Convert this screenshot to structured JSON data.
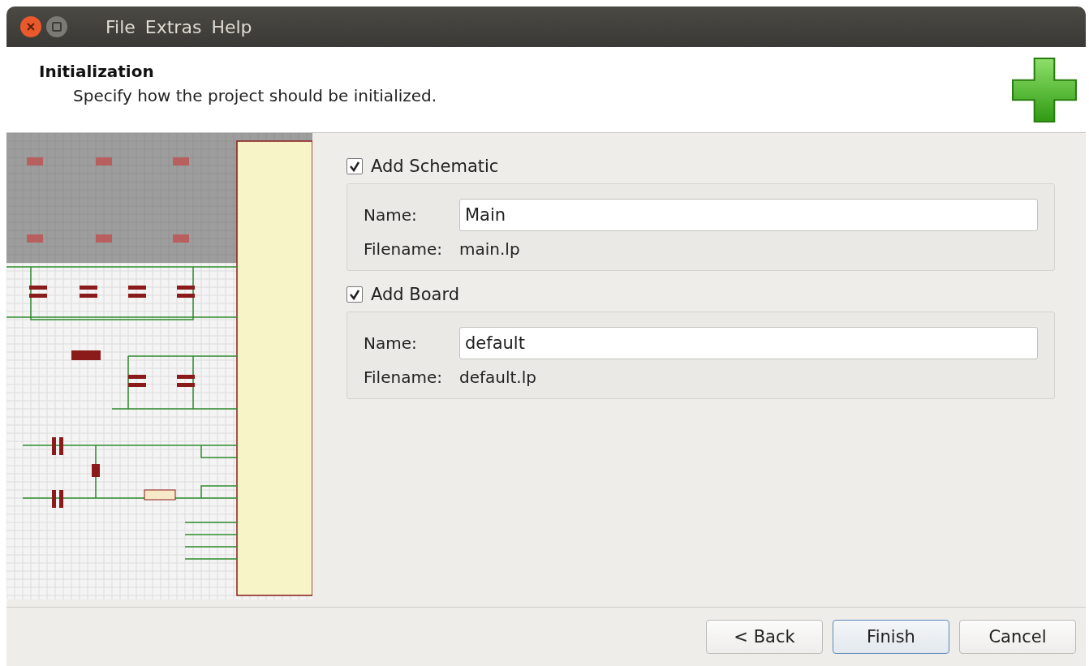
{
  "menu": [
    "File",
    "Extras",
    "Help"
  ],
  "header": {
    "title": "Initialization",
    "subtitle": "Specify how the project should be initialized."
  },
  "sections": [
    {
      "label": "Add Schematic",
      "checked": true,
      "name_label": "Name:",
      "name_value": "Main",
      "filename_label": "Filename:",
      "filename": "main.lp"
    },
    {
      "label": "Add Board",
      "checked": true,
      "name_label": "Name:",
      "name_value": "default",
      "filename_label": "Filename:",
      "filename": "default.lp"
    }
  ],
  "buttons": [
    {
      "label": "< Back",
      "default": false
    },
    {
      "label": "Finish",
      "default": true
    },
    {
      "label": "Cancel",
      "default": false
    }
  ]
}
